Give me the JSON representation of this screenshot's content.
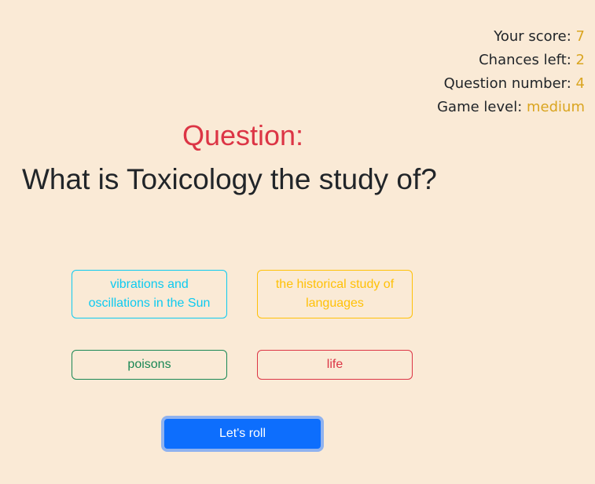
{
  "stats": {
    "score_label": "Your score: ",
    "score": "7",
    "chances_label": "Chances left: ",
    "chances": "2",
    "question_label": "Question number: ",
    "question": "4",
    "level_label": "Game level: ",
    "level": "medium"
  },
  "question": {
    "label": "Question:",
    "text": "What is Toxicology the study of?"
  },
  "answers": [
    {
      "text": "vibrations and oscillations in the Sun",
      "color": "#0dcaf0"
    },
    {
      "text": "the historical study of languages",
      "color": "#ffc107"
    },
    {
      "text": "poisons",
      "color": "#198754"
    },
    {
      "text": "life",
      "color": "#dc3545"
    }
  ],
  "roll_label": "Let's roll"
}
